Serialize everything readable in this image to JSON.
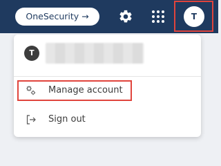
{
  "header": {
    "onesecurity_label": "OneSecurity →",
    "gear_icon": "gear-icon",
    "apps_icon": "apps-grid-icon",
    "avatar_initial": "T"
  },
  "menu": {
    "user_initial": "T",
    "items": [
      {
        "label": "Manage account",
        "icon": "manage-account-icon"
      },
      {
        "label": "Sign out",
        "icon": "sign-out-icon"
      }
    ]
  },
  "colors": {
    "topbar": "#1f3a5f",
    "highlight": "#e0443c"
  }
}
